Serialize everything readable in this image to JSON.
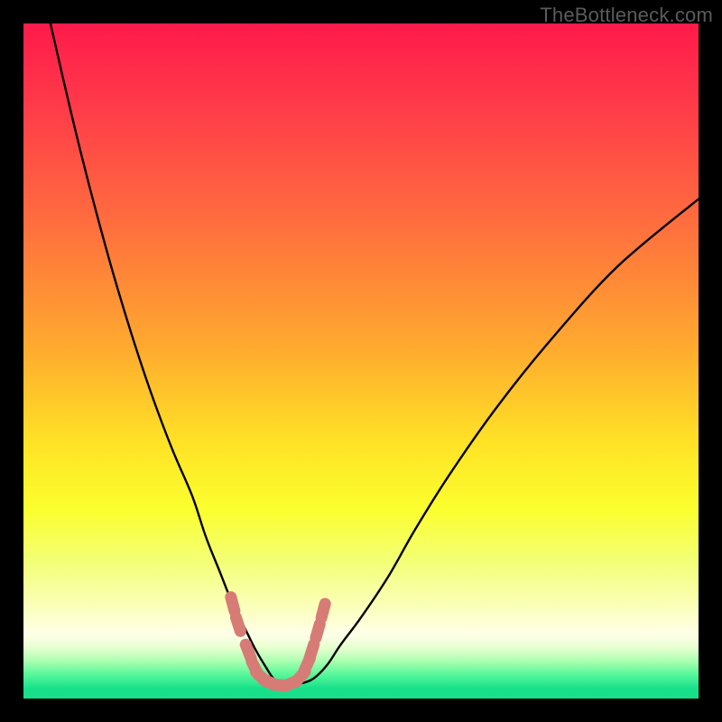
{
  "watermark": "TheBottleneck.com",
  "chart_data": {
    "type": "line",
    "title": "",
    "xlabel": "",
    "ylabel": "",
    "xlim": [
      0,
      100
    ],
    "ylim": [
      0,
      100
    ],
    "gradient_stops": [
      {
        "offset": 0.0,
        "color": "#ff1a4b"
      },
      {
        "offset": 0.12,
        "color": "#ff3a49"
      },
      {
        "offset": 0.3,
        "color": "#ff6f3e"
      },
      {
        "offset": 0.48,
        "color": "#ffaa2f"
      },
      {
        "offset": 0.62,
        "color": "#ffe226"
      },
      {
        "offset": 0.72,
        "color": "#fbff2e"
      },
      {
        "offset": 0.8,
        "color": "#f3ff79"
      },
      {
        "offset": 0.86,
        "color": "#faffb6"
      },
      {
        "offset": 0.905,
        "color": "#ffffe8"
      },
      {
        "offset": 0.925,
        "color": "#e6ffcf"
      },
      {
        "offset": 0.945,
        "color": "#a9ffb0"
      },
      {
        "offset": 0.965,
        "color": "#55f79a"
      },
      {
        "offset": 0.985,
        "color": "#18e08a"
      },
      {
        "offset": 1.0,
        "color": "#17df89"
      }
    ],
    "series": [
      {
        "name": "curve",
        "x": [
          4,
          7,
          10,
          13,
          16,
          19,
          22,
          25,
          27,
          29,
          31,
          33,
          34.5,
          36,
          37,
          38,
          39,
          41,
          43,
          45,
          47,
          50,
          54,
          58,
          63,
          70,
          78,
          88,
          100
        ],
        "y": [
          100,
          87,
          75,
          64,
          54,
          45,
          37,
          30,
          24,
          19,
          14,
          10,
          7,
          4.5,
          3,
          2.2,
          2,
          2.2,
          3,
          5,
          8,
          12,
          18,
          25,
          33,
          43,
          53,
          64,
          74
        ],
        "note": "curve y is bottleneck-% (0=none, 100=max); plotted with 0 at the bottom"
      },
      {
        "name": "dotted-overlay",
        "x": [
          31.0,
          31.8,
          33.3,
          34.3,
          35.2,
          36.5,
          38.0,
          39.5,
          41.0,
          42.0,
          42.7,
          43.6,
          44.4
        ],
        "y": [
          14.0,
          11.0,
          7.0,
          4.5,
          3.2,
          2.4,
          2.0,
          2.2,
          3.2,
          5.0,
          7.0,
          10.0,
          13.0
        ]
      }
    ],
    "marker_color": "#d77b76",
    "curve_color": "#000000"
  }
}
